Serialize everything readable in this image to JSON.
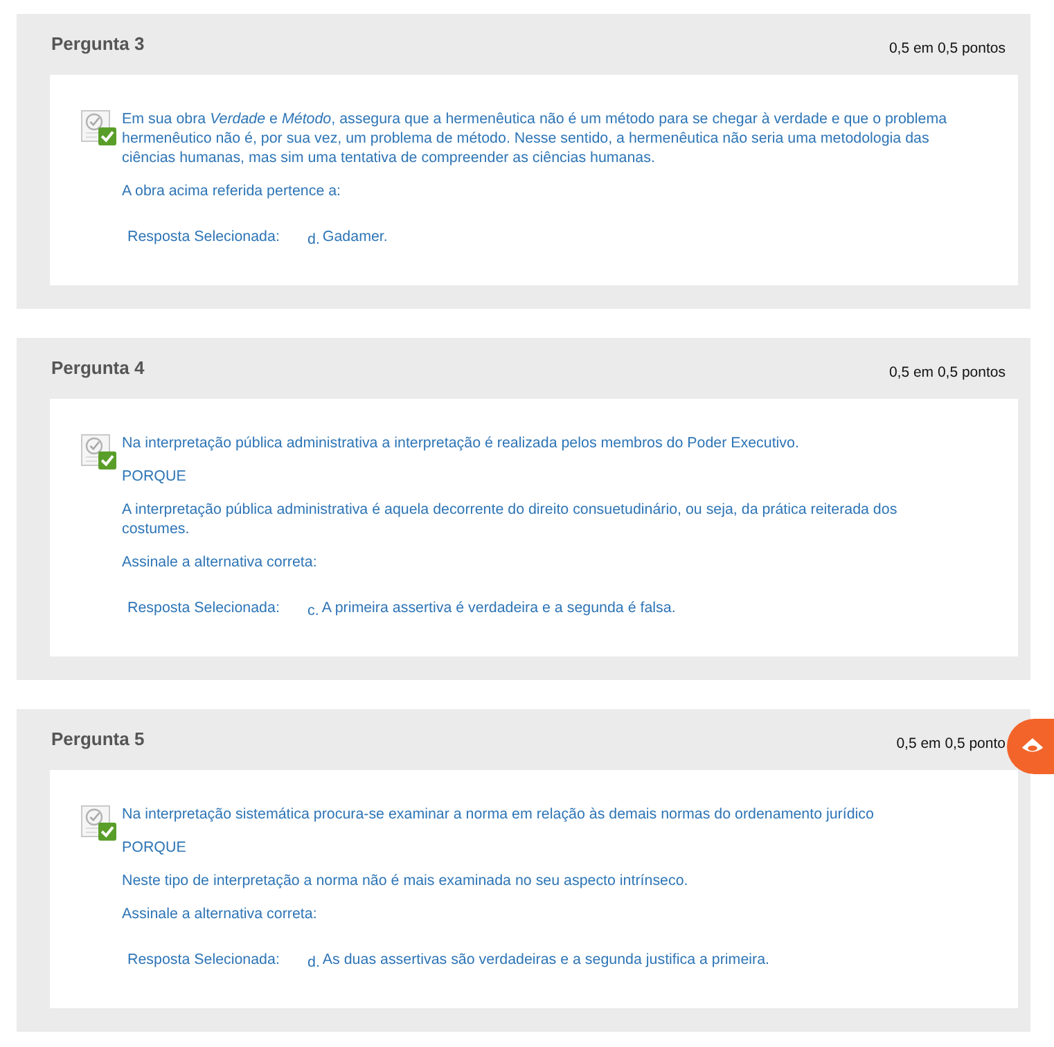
{
  "questions": [
    {
      "title": "Pergunta 3",
      "score": "0,5 em 0,5 pontos",
      "correct": true,
      "paragraphs": [
        "Em sua obra *Verdade* e *Método*, assegura que a hermenêutica não é um método para se chegar à verdade e que o problema hermenêutico não é, por sua vez, um problema de método. Nesse sentido, a hermenêutica não seria uma metodologia das ciências humanas, mas sim uma tentativa de compreender as ciências humanas.",
        "A obra acima referida pertence a:"
      ],
      "answer": {
        "label": "Resposta Selecionada:",
        "letter": "d.",
        "text": "Gadamer."
      }
    },
    {
      "title": "Pergunta 4",
      "score": "0,5 em 0,5 pontos",
      "correct": true,
      "paragraphs": [
        "Na interpretação pública administrativa a interpretação é realizada pelos membros do Poder Executivo.",
        "PORQUE",
        "A interpretação pública administrativa é aquela decorrente do direito consuetudinário, ou seja, da prática reiterada dos costumes.",
        "Assinale a alternativa correta:"
      ],
      "answer": {
        "label": "Resposta Selecionada:",
        "letter": "c.",
        "text": "A primeira assertiva é verdadeira e a segunda é falsa."
      }
    },
    {
      "title": "Pergunta 5",
      "score": "0,5 em 0,5 ponto",
      "correct": true,
      "paragraphs": [
        "Na interpretação sistemática procura-se examinar a norma em relação às demais normas do ordenamento jurídico",
        "PORQUE",
        "Neste tipo de interpretação a norma não é mais examinada no seu aspecto intrínseco.",
        "Assinale a alternativa correta:"
      ],
      "answer": {
        "label": "Resposta Selecionada:",
        "letter": "d.",
        "text": "As duas assertivas são verdadeiras e a segunda justifica a primeira."
      }
    }
  ]
}
